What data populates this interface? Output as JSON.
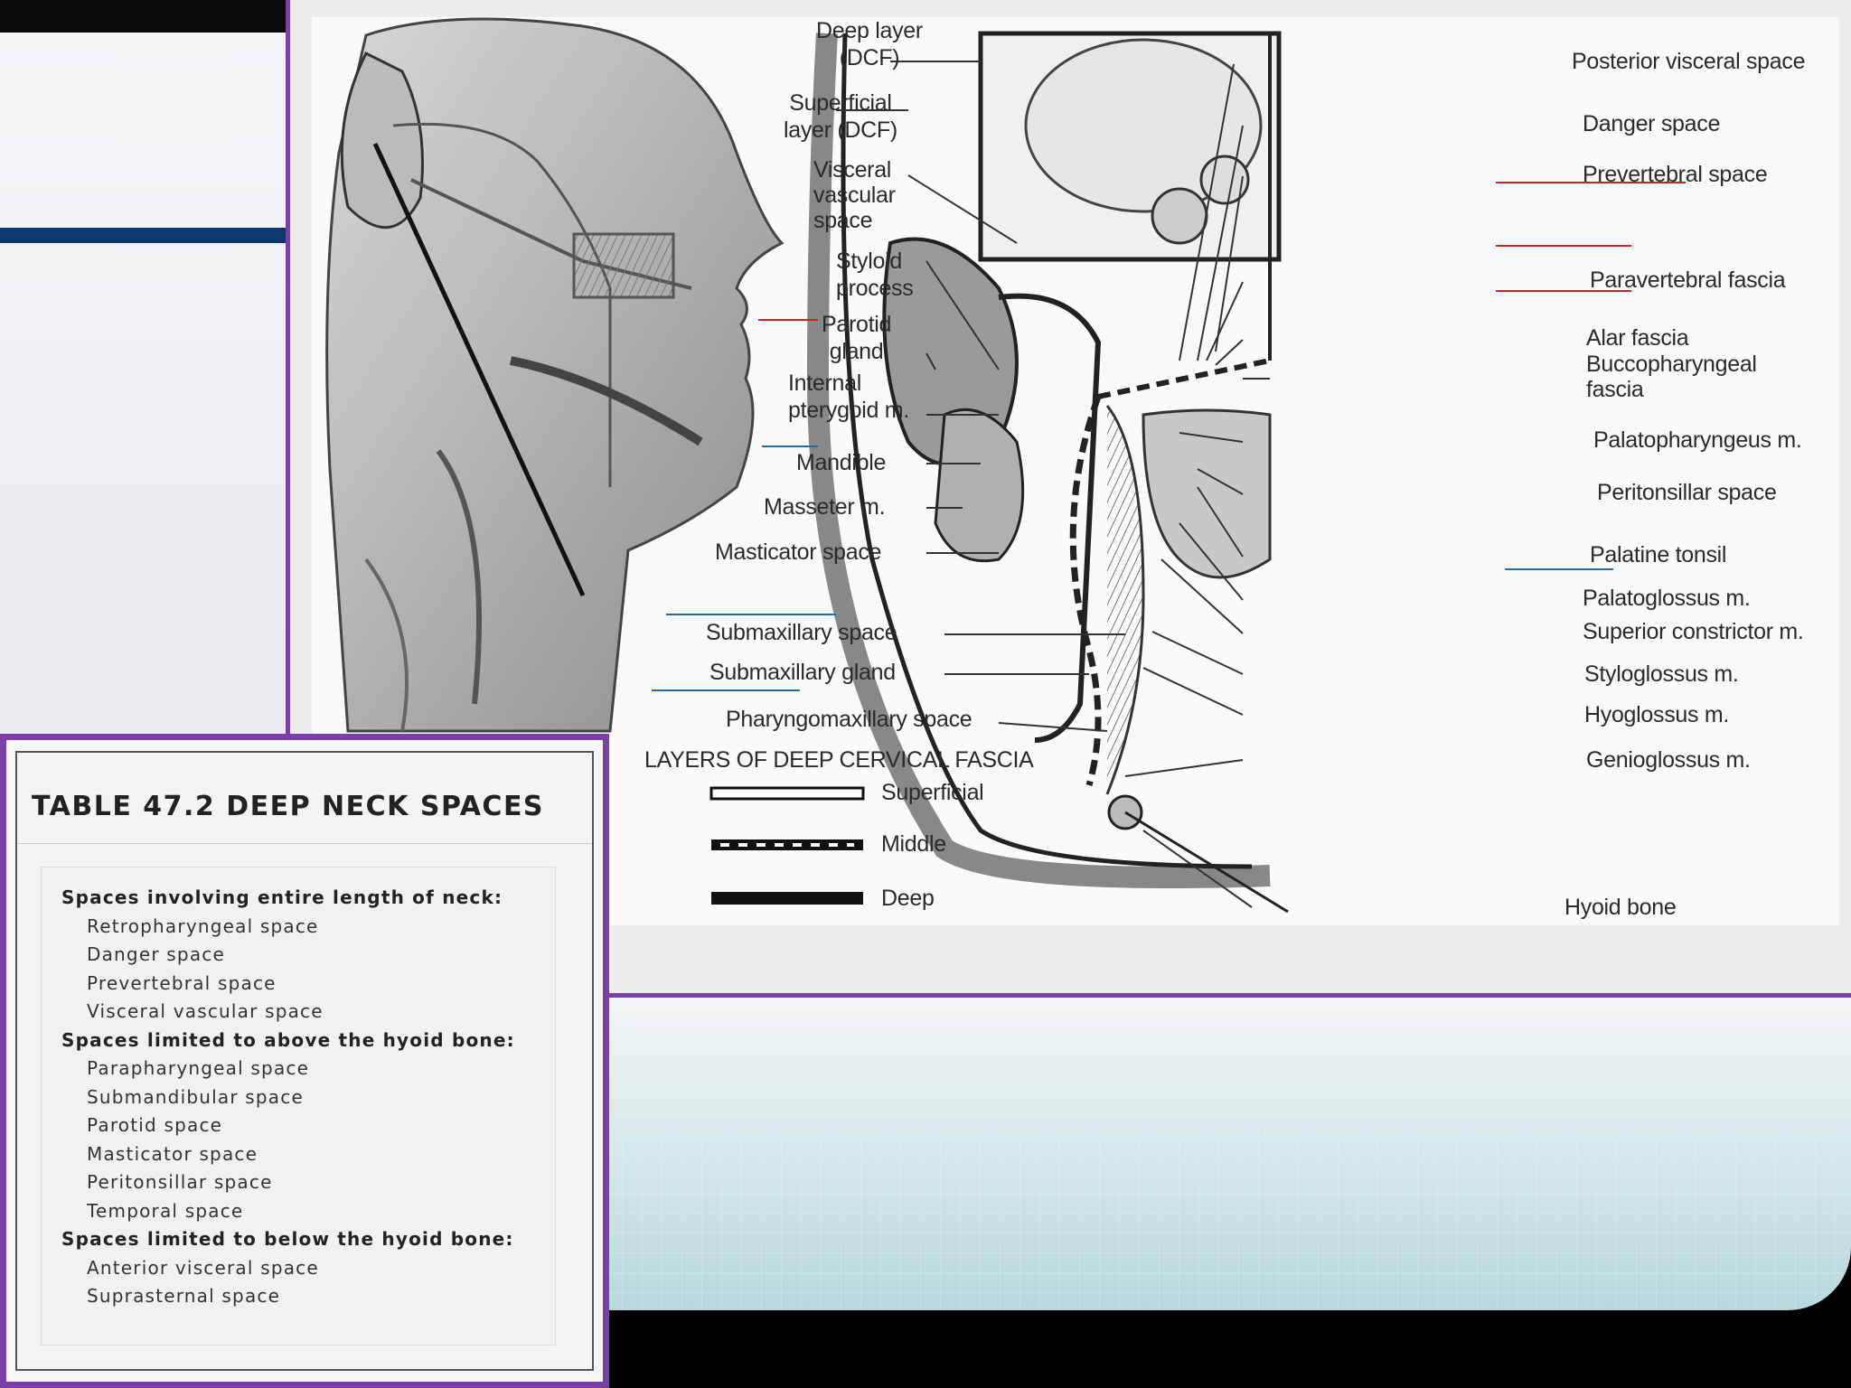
{
  "labels": {
    "deep_layer": [
      "Deep layer",
      "(DCF)"
    ],
    "superficial_layer": [
      "Superficial",
      "layer (DCF)"
    ],
    "visceral_vascular": [
      "Visceral",
      "vascular",
      "space"
    ],
    "styloid": [
      "Styloid",
      "process"
    ],
    "parotid": [
      "Parotid",
      "gland"
    ],
    "internal_pterygoid": [
      "Internal",
      "pterygoid m."
    ],
    "mandible": "Mandible",
    "masseter": "Masseter m.",
    "masticator": "Masticator space",
    "submaxillary_space": "Submaxillary space",
    "submaxillary_gland": "Submaxillary gland",
    "pharyngomaxillary": "Pharyngomaxillary space",
    "posterior_visceral": "Posterior visceral space",
    "danger": "Danger space",
    "prevertebral": "Prevertebral space",
    "paravertebral": "Paravertebral fascia",
    "alar": "Alar fascia",
    "buccopharyngeal": [
      "Buccopharyngeal",
      "fascia"
    ],
    "palatopharyngeus": "Palatopharyngeus m.",
    "peritonsillar": "Peritonsillar space",
    "palatine_tonsil": "Palatine tonsil",
    "palatoglossus": "Palatoglossus m.",
    "superior_constrictor": "Superior constrictor m.",
    "styloglossus": "Styloglossus m.",
    "hyoglossus": "Hyoglossus m.",
    "genioglossus": "Genioglossus m.",
    "hyoid": "Hyoid bone"
  },
  "legend": {
    "title": "LAYERS OF DEEP CERVICAL FASCIA",
    "items": [
      "Superficial",
      "Middle",
      "Deep"
    ]
  },
  "table": {
    "title": "TABLE 47.2 DEEP NECK SPACES",
    "groups": [
      {
        "heading": "Spaces involving entire length of neck:",
        "items": [
          "Retropharyngeal space",
          "Danger space",
          "Prevertebral space",
          "Visceral vascular space"
        ]
      },
      {
        "heading": "Spaces limited to above the hyoid bone:",
        "items": [
          "Parapharyngeal space",
          "Submandibular space",
          "Parotid space",
          "Masticator space",
          "Peritonsillar space",
          "Temporal space"
        ]
      },
      {
        "heading": "Spaces limited to below the hyoid bone:",
        "items": [
          "Anterior visceral space",
          "Suprasternal space"
        ]
      }
    ]
  },
  "colors": {
    "frame": "#7b3fa8",
    "blue_bar": "#0a3a6e",
    "annotation_red": "#cc2222",
    "annotation_blue": "#2a6a9a"
  }
}
